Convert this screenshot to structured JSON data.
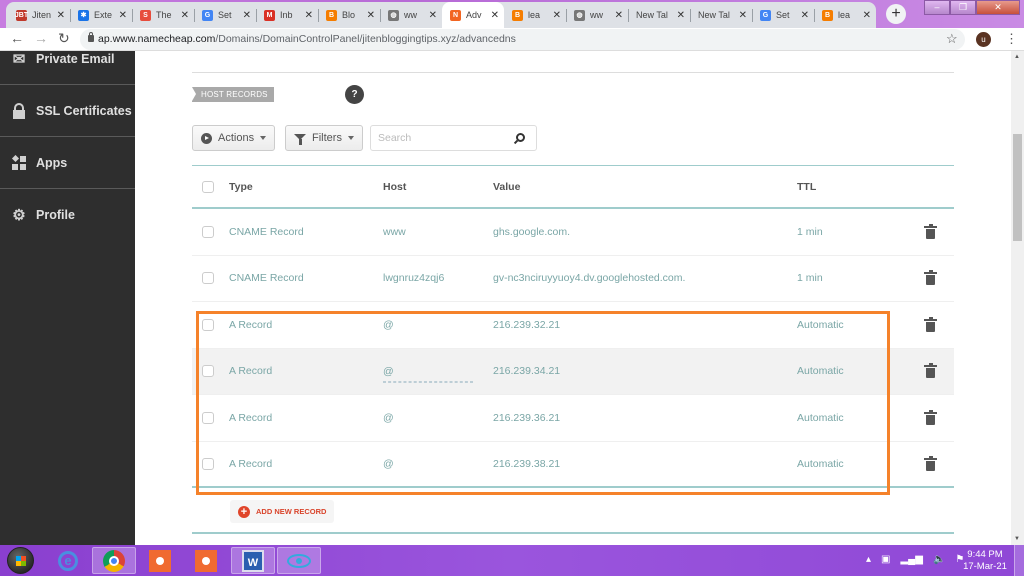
{
  "browser": {
    "tabs": [
      {
        "title": "Jiten",
        "favicon": "jbt-icon",
        "color": "#c0392b",
        "glyph": "JBT"
      },
      {
        "title": "Exte",
        "favicon": "puzzle-icon",
        "color": "#1a73e8",
        "glyph": "✱"
      },
      {
        "title": "The",
        "favicon": "s-logo-icon",
        "color": "#e74c3c",
        "glyph": "S"
      },
      {
        "title": "Set",
        "favicon": "google-icon",
        "color": "#4285f4",
        "glyph": "G"
      },
      {
        "title": "Inb",
        "favicon": "gmail-icon",
        "color": "#d93025",
        "glyph": "M"
      },
      {
        "title": "Blo",
        "favicon": "blogger-icon",
        "color": "#f57d00",
        "glyph": "B"
      },
      {
        "title": "ww",
        "favicon": "globe-icon",
        "color": "#777777",
        "glyph": "◍"
      },
      {
        "title": "Adv",
        "favicon": "namecheap-icon",
        "color": "#f26522",
        "glyph": "N",
        "active": true
      },
      {
        "title": "lea",
        "favicon": "blogger-icon",
        "color": "#f57d00",
        "glyph": "B"
      },
      {
        "title": "ww",
        "favicon": "globe-icon",
        "color": "#777777",
        "glyph": "◍"
      },
      {
        "title": "New Tal",
        "favicon": "",
        "color": "",
        "glyph": ""
      },
      {
        "title": "New Tal",
        "favicon": "",
        "color": "",
        "glyph": ""
      },
      {
        "title": "Set",
        "favicon": "google-icon",
        "color": "#4285f4",
        "glyph": "G"
      },
      {
        "title": "lea",
        "favicon": "blogger-icon",
        "color": "#f57d00",
        "glyph": "B"
      }
    ],
    "new_tab": "+",
    "url_host": "ap.www.namecheap.com",
    "url_path": "/Domains/DomainControlPanel/jitenbloggingtips.xyz/advancedns",
    "profile_initial": "u"
  },
  "sidebar": {
    "items": [
      {
        "label": "Private Email",
        "icon": "envelope-icon"
      },
      {
        "label": "SSL Certificates",
        "icon": "lock-icon"
      },
      {
        "label": "Apps",
        "icon": "apps-icon"
      },
      {
        "label": "Profile",
        "icon": "gear-icon"
      }
    ]
  },
  "main": {
    "section_label": "HOST RECORDS",
    "help": "?",
    "actions_label": "Actions",
    "filters_label": "Filters",
    "search_placeholder": "Search",
    "columns": {
      "type": "Type",
      "host": "Host",
      "value": "Value",
      "ttl": "TTL"
    },
    "records": [
      {
        "type": "CNAME Record",
        "host": "www",
        "value": "ghs.google.com.",
        "ttl": "1 min"
      },
      {
        "type": "CNAME Record",
        "host": "lwgnruz4zqj6",
        "value": "gv-nc3nciruyyuoy4.dv.googlehosted.com.",
        "ttl": "1 min"
      },
      {
        "type": "A Record",
        "host": "@",
        "value": "216.239.32.21",
        "ttl": "Automatic"
      },
      {
        "type": "A Record",
        "host": "@",
        "value": "216.239.34.21",
        "ttl": "Automatic",
        "hovered": true
      },
      {
        "type": "A Record",
        "host": "@",
        "value": "216.239.36.21",
        "ttl": "Automatic"
      },
      {
        "type": "A Record",
        "host": "@",
        "value": "216.239.38.21",
        "ttl": "Automatic"
      }
    ],
    "add_record_label": "ADD NEW RECORD",
    "highlight_color": "#f5822a"
  },
  "taskbar": {
    "time": "9:44 PM",
    "date": "17-Mar-21"
  }
}
